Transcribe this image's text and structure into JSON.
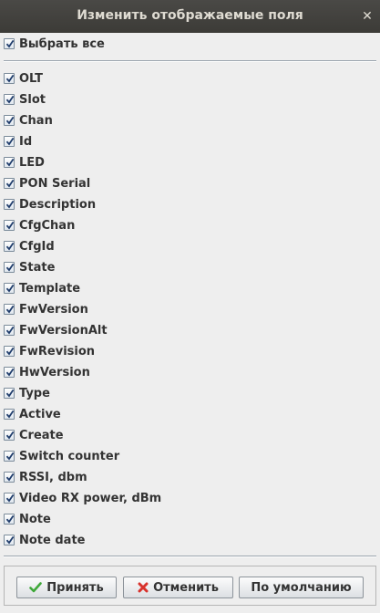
{
  "window": {
    "title": "Изменить отображаемые поля",
    "close_glyph": "✕"
  },
  "select_all": {
    "label": "Выбрать все",
    "checked": true
  },
  "fields": [
    {
      "label": "OLT",
      "checked": true
    },
    {
      "label": "Slot",
      "checked": true
    },
    {
      "label": "Chan",
      "checked": true
    },
    {
      "label": "Id",
      "checked": true
    },
    {
      "label": "LED",
      "checked": true
    },
    {
      "label": "PON Serial",
      "checked": true
    },
    {
      "label": "Description",
      "checked": true
    },
    {
      "label": "CfgChan",
      "checked": true
    },
    {
      "label": "CfgId",
      "checked": true
    },
    {
      "label": "State",
      "checked": true
    },
    {
      "label": "Template",
      "checked": true
    },
    {
      "label": "FwVersion",
      "checked": true
    },
    {
      "label": "FwVersionAlt",
      "checked": true
    },
    {
      "label": "FwRevision",
      "checked": true
    },
    {
      "label": "HwVersion",
      "checked": true
    },
    {
      "label": "Type",
      "checked": true
    },
    {
      "label": "Active",
      "checked": true
    },
    {
      "label": "Create",
      "checked": true
    },
    {
      "label": "Switch counter",
      "checked": true
    },
    {
      "label": "RSSI, dbm",
      "checked": true
    },
    {
      "label": "Video RX power, dBm",
      "checked": true
    },
    {
      "label": "Note",
      "checked": true
    },
    {
      "label": "Note date",
      "checked": true
    }
  ],
  "buttons": {
    "accept": {
      "label": "Принять",
      "icon": "checkmark-icon",
      "icon_color": "#3fa83a"
    },
    "cancel": {
      "label": "Отменить",
      "icon": "cross-icon",
      "icon_color": "#d8322c"
    },
    "default": {
      "label": "По умолчанию"
    }
  },
  "colors": {
    "titlebar": "#3c3b37",
    "title_text": "#dfdbd2",
    "checkmark": "#1f3c6b"
  }
}
